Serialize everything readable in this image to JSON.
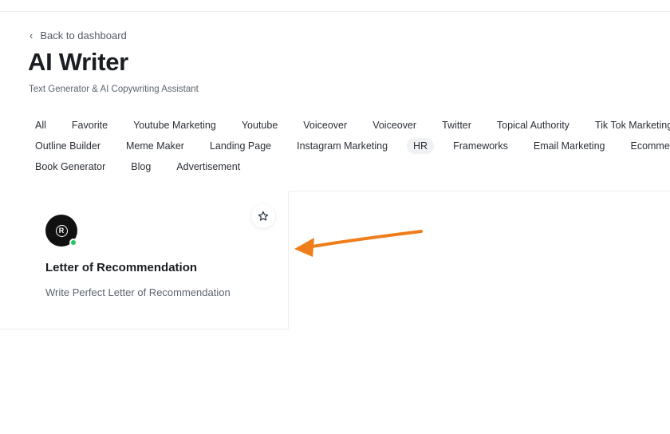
{
  "nav": {
    "back_label": "Back to dashboard",
    "back_icon": "chevron-left-icon"
  },
  "header": {
    "title": "AI Writer",
    "subtitle": "Text Generator & AI Copywriting Assistant"
  },
  "filters": {
    "rows": [
      [
        "All",
        "Favorite",
        "Youtube Marketing",
        "Youtube",
        "Voiceover",
        "Voiceover",
        "Twitter",
        "Topical Authority",
        "Tik Tok Marketing"
      ],
      [
        "Outline Builder",
        "Meme Maker",
        "Landing Page",
        "Instagram Marketing",
        "HR",
        "Frameworks",
        "Email Marketing",
        "Ecommerce"
      ],
      [
        "Book Generator",
        "Blog",
        "Advertisement"
      ]
    ],
    "active": "HR"
  },
  "card": {
    "icon": "registered-icon",
    "title": "Letter of Recommendation",
    "description": "Write Perfect Letter of Recommendation",
    "status_color": "#22c55e",
    "favorite_icon": "star-icon"
  },
  "annotation": {
    "icon": "arrow-annotation-icon",
    "color": "#f07d1b"
  }
}
